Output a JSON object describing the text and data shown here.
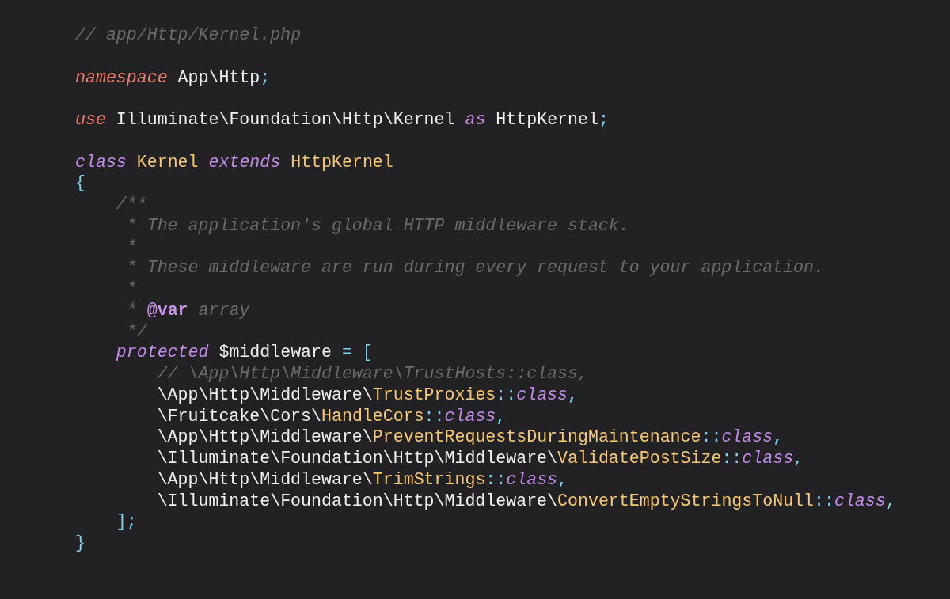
{
  "editor": {
    "lines": [
      {
        "tokens": [
          {
            "kind": "comment",
            "text": "// app/Http/Kernel.php"
          }
        ]
      },
      {
        "blank_before": true,
        "tokens": [
          {
            "kind": "keyword",
            "text": "namespace"
          },
          {
            "kind": "plain",
            "text": "App\\Http"
          },
          {
            "kind": "punct",
            "text": ";"
          }
        ]
      },
      {
        "blank_before": true,
        "tokens": [
          {
            "kind": "keyword",
            "text": "use"
          },
          {
            "kind": "plain",
            "text": "Illuminate\\Foundation\\Http\\Kernel"
          },
          {
            "kind": "storage",
            "text": "as"
          },
          {
            "kind": "plain",
            "text": "HttpKernel"
          },
          {
            "kind": "punct",
            "text": ";"
          }
        ]
      },
      {
        "blank_before": true,
        "tokens": [
          {
            "kind": "storage",
            "text": "class"
          },
          {
            "kind": "type",
            "text": "Kernel"
          },
          {
            "kind": "storage",
            "text": "extends"
          },
          {
            "kind": "type",
            "text": "HttpKernel"
          }
        ]
      },
      {
        "tokens": [
          {
            "kind": "punct",
            "text": "{"
          }
        ],
        "children": [
          {
            "tokens": [
              {
                "kind": "comment",
                "text": "/**"
              }
            ]
          },
          {
            "tokens": [
              {
                "kind": "comment",
                "text": " * The application's global HTTP middleware stack."
              }
            ]
          },
          {
            "tokens": [
              {
                "kind": "comment",
                "text": " *"
              }
            ]
          },
          {
            "tokens": [
              {
                "kind": "comment",
                "text": " * These middleware are run during every request to your application."
              }
            ]
          },
          {
            "tokens": [
              {
                "kind": "comment",
                "text": " *"
              }
            ]
          },
          {
            "tokens": [
              {
                "kind": "comment",
                "text": " *"
              },
              {
                "kind": "doctag",
                "text": "@var"
              },
              {
                "kind": "comment",
                "text": "array"
              }
            ]
          },
          {
            "tokens": [
              {
                "kind": "comment",
                "text": " */"
              }
            ]
          },
          {
            "tokens": [
              {
                "kind": "storage",
                "text": "protected"
              },
              {
                "kind": "plain",
                "text": "$middleware"
              },
              {
                "kind": "punct",
                "text": "= ["
              }
            ],
            "children": [
              {
                "tokens": [
                  {
                    "kind": "comment",
                    "text": "// \\App\\Http\\Middleware\\TrustHosts::class,"
                  }
                ]
              },
              {
                "tokens": [
                  {
                    "kind": "plain",
                    "text": "\\App\\Http\\Middleware\\"
                  },
                  {
                    "kind": "type",
                    "text": "TrustProxies"
                  },
                  {
                    "kind": "punct",
                    "text": "::"
                  },
                  {
                    "kind": "storage",
                    "text": "class"
                  },
                  {
                    "kind": "punct",
                    "text": ","
                  }
                ]
              },
              {
                "tokens": [
                  {
                    "kind": "plain",
                    "text": "\\Fruitcake\\Cors\\"
                  },
                  {
                    "kind": "type",
                    "text": "HandleCors"
                  },
                  {
                    "kind": "punct",
                    "text": "::"
                  },
                  {
                    "kind": "storage",
                    "text": "class"
                  },
                  {
                    "kind": "punct",
                    "text": ","
                  }
                ]
              },
              {
                "tokens": [
                  {
                    "kind": "plain",
                    "text": "\\App\\Http\\Middleware\\"
                  },
                  {
                    "kind": "type",
                    "text": "PreventRequestsDuringMaintenance"
                  },
                  {
                    "kind": "punct",
                    "text": "::"
                  },
                  {
                    "kind": "storage",
                    "text": "class"
                  },
                  {
                    "kind": "punct",
                    "text": ","
                  }
                ]
              },
              {
                "tokens": [
                  {
                    "kind": "plain",
                    "text": "\\Illuminate\\Foundation\\Http\\Middleware\\"
                  },
                  {
                    "kind": "type",
                    "text": "ValidatePostSize"
                  },
                  {
                    "kind": "punct",
                    "text": "::"
                  },
                  {
                    "kind": "storage",
                    "text": "class"
                  },
                  {
                    "kind": "punct",
                    "text": ","
                  }
                ]
              },
              {
                "tokens": [
                  {
                    "kind": "plain",
                    "text": "\\App\\Http\\Middleware\\"
                  },
                  {
                    "kind": "type",
                    "text": "TrimStrings"
                  },
                  {
                    "kind": "punct",
                    "text": "::"
                  },
                  {
                    "kind": "storage",
                    "text": "class"
                  },
                  {
                    "kind": "punct",
                    "text": ","
                  }
                ]
              },
              {
                "tokens": [
                  {
                    "kind": "plain",
                    "text": "\\Illuminate\\Foundation\\Http\\Middleware\\"
                  },
                  {
                    "kind": "type",
                    "text": "ConvertEmptyStringsToNull"
                  },
                  {
                    "kind": "punct",
                    "text": "::"
                  },
                  {
                    "kind": "storage",
                    "text": "class"
                  },
                  {
                    "kind": "punct",
                    "text": ","
                  }
                ]
              }
            ]
          },
          {
            "tokens": [
              {
                "kind": "punct",
                "text": "];"
              }
            ]
          }
        ]
      },
      {
        "tokens": [
          {
            "kind": "punct",
            "text": "}"
          }
        ]
      }
    ]
  }
}
